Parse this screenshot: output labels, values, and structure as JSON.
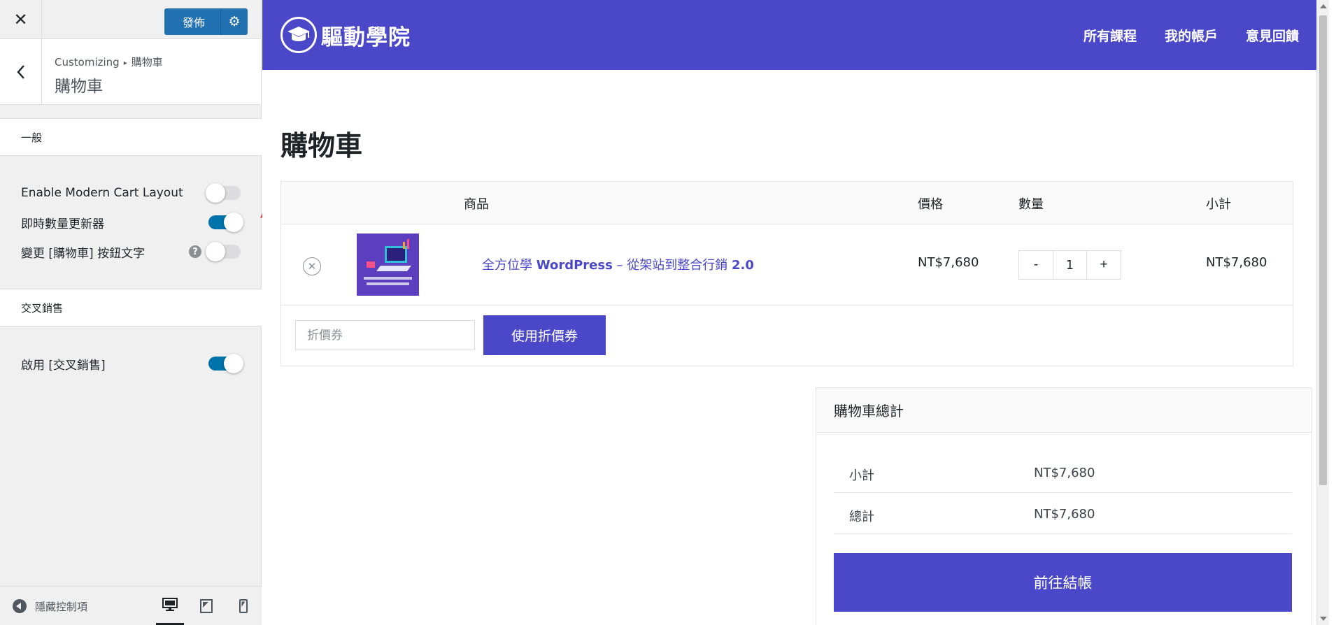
{
  "sidebar": {
    "publish_label": "發佈",
    "breadcrumb_root": "Customizing",
    "breadcrumb_sep": "▸",
    "breadcrumb_current": "購物車",
    "title": "購物車",
    "sections": [
      {
        "label": "一般"
      },
      {
        "label": "交叉銷售"
      }
    ],
    "options": [
      {
        "label": "Enable Modern Cart Layout",
        "on": false
      },
      {
        "label": "即時數量更新器",
        "on": true
      },
      {
        "label": "變更 [購物車] 按鈕文字",
        "on": false
      },
      {
        "label": "啟用 [交叉銷售]",
        "on": true
      }
    ],
    "help_glyph": "?",
    "hide_controls": "隱藏控制項"
  },
  "site": {
    "logo_text": "驅動學院",
    "nav": [
      "所有課程",
      "我的帳戶",
      "意見回饋"
    ],
    "brand_color": "#4a47c9"
  },
  "cart": {
    "page_title": "購物車",
    "headers": {
      "product": "商品",
      "price": "價格",
      "quantity": "數量",
      "subtotal": "小計"
    },
    "items": [
      {
        "name_pre": "全方位學 ",
        "name_wp": "WordPress",
        "name_post": " – 從架站到整合行銷 ",
        "name_ver": "2.0",
        "price": "NT$7,680",
        "qty": "1",
        "subtotal": "NT$7,680",
        "minus": "-",
        "plus": "+"
      }
    ],
    "coupon_placeholder": "折價券",
    "coupon_button": "使用折價券"
  },
  "totals": {
    "title": "購物車總計",
    "rows": [
      {
        "label": "小計",
        "value": "NT$7,680"
      },
      {
        "label": "總計",
        "value": "NT$7,680"
      }
    ],
    "checkout_label": "前往結帳"
  }
}
